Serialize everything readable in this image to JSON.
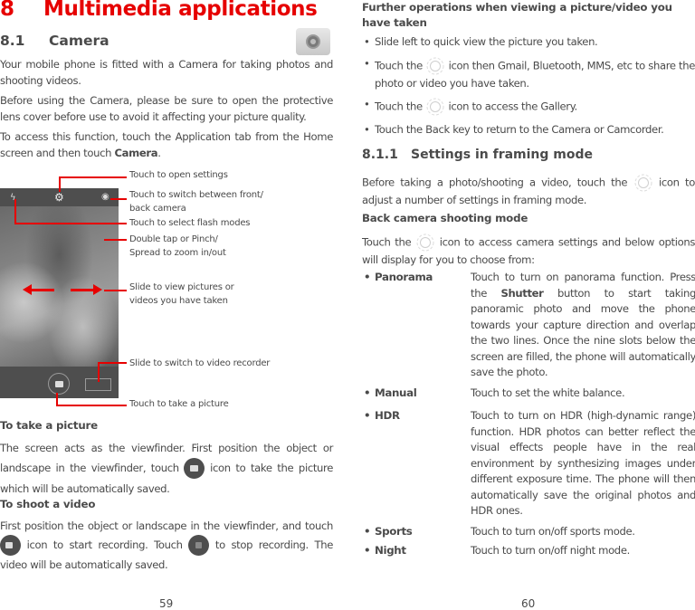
{
  "left_page": {
    "chapter": {
      "number": "8",
      "title": "Multimedia applications"
    },
    "section": {
      "number": "8.1",
      "title": "Camera"
    },
    "intro": [
      "Your mobile phone is fitted with a Camera for taking photos and shooting videos.",
      "Before using the Camera, please be sure to open the protective lens cover before use to avoid it affecting your picture quality."
    ],
    "access": {
      "text": "To access this function, touch the Application tab from the Home screen and then touch ",
      "bold": "Camera",
      "end": "."
    },
    "callouts": [
      "Touch to open settings",
      "Touch to switch between front/ back camera",
      "Touch to select flash modes",
      "Double tap or Pinch/ Spread to zoom in/out",
      "Slide to view pictures or videos you have taken",
      "Slide to switch to video recorder",
      "Touch to take a picture"
    ],
    "take_picture": {
      "heading": "To take a picture",
      "text_before": "The screen acts as the viewfinder. First position the object or landscape in the viewfinder, touch ",
      "text_after": " icon to take the picture which will be automatically saved."
    },
    "shoot_video": {
      "heading": "To shoot a video",
      "text_before": "First position the object or landscape in the viewfinder, and touch ",
      "text_middle": " icon to start recording. Touch ",
      "text_after": " to stop recording. The video will be automatically saved."
    },
    "page_number": "59"
  },
  "right_page": {
    "further_heading": "Further operations when viewing a picture/video you have taken",
    "further_items": [
      {
        "before": "Slide left to quick view the picture you taken.",
        "after": ""
      },
      {
        "before": "Touch the ",
        "after": " icon then Gmail, Bluetooth, MMS, etc to share the photo or video you have taken."
      },
      {
        "before": "Touch the ",
        "after": " icon to access the Gallery."
      },
      {
        "before": "Touch the Back key to return to the Camera or Camcorder.",
        "after": ""
      }
    ],
    "subsection": {
      "number": "8.1.1",
      "title": "Settings in framing mode"
    },
    "framing_text": {
      "before": "Before taking a photo/shooting a video, touch the ",
      "after": " icon to adjust a number of settings  in framing mode."
    },
    "back_camera_heading": "Back camera shooting mode",
    "back_camera_text": {
      "before": "Touch the ",
      "after": " icon to access camera settings and below options will display for you to choose from:"
    },
    "options": [
      {
        "label": "Panorama",
        "desc_before": "Touch to turn on panorama function. Press the ",
        "desc_bold": "Shutter",
        "desc_after": " button to start taking panoramic photo and move the phone towards your capture direction and overlap the two lines. Once the nine slots below the screen are filled, the phone will automatically save the photo."
      },
      {
        "label": "Manual",
        "desc_before": "Touch to set the white balance.",
        "desc_bold": "",
        "desc_after": ""
      },
      {
        "label": "HDR",
        "desc_before": "Touch to turn on HDR (high-dynamic range) function. HDR photos can better reflect the visual effects people have in the real environment by synthesizing images under different exposure time. The phone will then automatically save the original photos and HDR ones.",
        "desc_bold": "",
        "desc_after": ""
      },
      {
        "label": "Sports",
        "desc_before": "Touch to turn on/off sports mode.",
        "desc_bold": "",
        "desc_after": ""
      },
      {
        "label": "Night",
        "desc_before": "Touch to turn on/off night mode.",
        "desc_bold": "",
        "desc_after": ""
      }
    ],
    "page_number": "60"
  },
  "colors": {
    "accent": "#e60000",
    "text": "#4a4a4a",
    "camera_bar": "#4e4e4e"
  }
}
